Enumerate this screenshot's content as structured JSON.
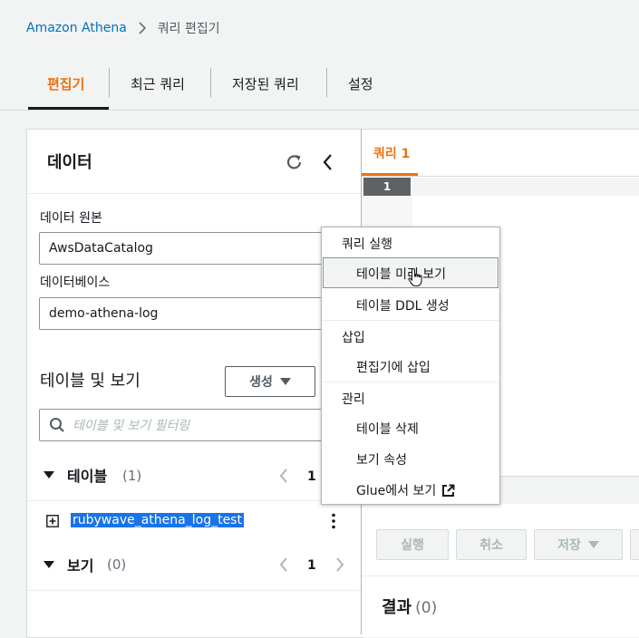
{
  "breadcrumb": {
    "root": "Amazon Athena",
    "current": "쿼리 편집기"
  },
  "tabs": [
    {
      "label": "편집기"
    },
    {
      "label": "최근 쿼리"
    },
    {
      "label": "저장된 쿼리"
    },
    {
      "label": "설정"
    }
  ],
  "data_panel": {
    "title": "데이터",
    "source_label": "데이터 원본",
    "source_value": "AwsDataCatalog",
    "database_label": "데이터베이스",
    "database_value": "demo-athena-log",
    "tables_views_title": "테이블 및 보기",
    "create_button": "생성",
    "filter_placeholder": "테이블 및 보기 필터링",
    "tables_section": {
      "label": "테이블",
      "count": "(1)",
      "page": "1"
    },
    "table_items": [
      {
        "name": "rubywave_athena_log_test"
      }
    ],
    "views_section": {
      "label": "보기",
      "count": "(0)",
      "page": "1"
    }
  },
  "editor": {
    "query_tab": "쿼리 1",
    "line_number": "1",
    "buttons": {
      "run": "실행",
      "cancel": "취소",
      "save": "저장"
    },
    "results_title": "결과",
    "results_count": "(0)"
  },
  "context_menu": {
    "groups": [
      {
        "title": "쿼리 실행",
        "items": [
          "테이블 미리 보기",
          "테이블 DDL 생성"
        ]
      },
      {
        "title": "삽입",
        "items": [
          "편집기에 삽입"
        ]
      },
      {
        "title": "관리",
        "items": [
          "테이블 삭제",
          "보기 속성",
          "Glue에서 보기"
        ]
      }
    ]
  },
  "colors": {
    "accent": "#ec7211",
    "link": "#0073bb",
    "selection": "#1a73e8"
  }
}
